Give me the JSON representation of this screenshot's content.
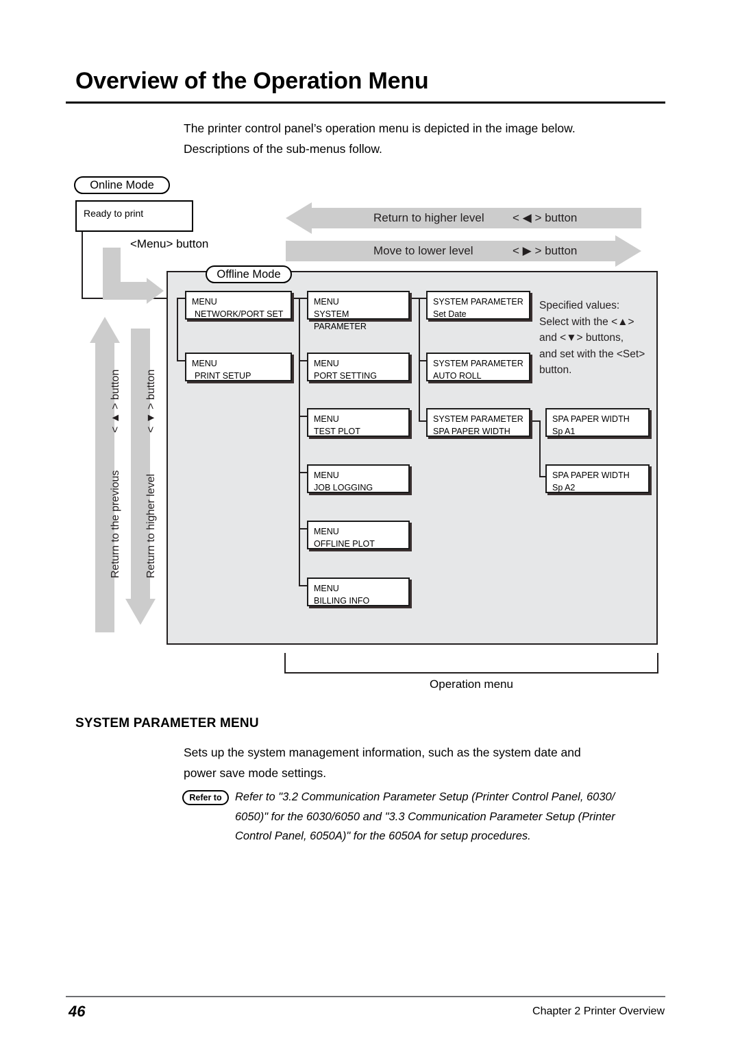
{
  "page": {
    "title": "Overview of the Operation Menu",
    "intro_line1": "The printer control panel’s operation menu is depicted in the image below.",
    "intro_line2": "Descriptions of the sub-menus follow."
  },
  "diagram": {
    "online_mode_pill": "Online Mode",
    "ready_box": "Ready to print",
    "menu_button_label": "<Menu> button",
    "offline_mode_pill": "Offline Mode",
    "operation_menu_caption": "Operation menu",
    "arrows": {
      "top_left_arrow": "Return to higher level",
      "top_left_button": "< ◀ > button",
      "top_right_arrow": "Move to lower level",
      "top_right_button": "< ▶ > button",
      "vert_up_label": "Return to the previous",
      "vert_up_button": "< ▲ > button",
      "vert_down_label": "Return to higher level",
      "vert_down_button": "< ▼ > button"
    },
    "column1": [
      {
        "line1": "MENU",
        "line2": "NETWORK/PORT SET"
      },
      {
        "line1": "MENU",
        "line2": "PRINT SETUP"
      }
    ],
    "column2": [
      {
        "line1": "MENU",
        "line2": "SYSTEM PARAMETER"
      },
      {
        "line1": "MENU",
        "line2": "PORT SETTING"
      },
      {
        "line1": "MENU",
        "line2": "TEST PLOT"
      },
      {
        "line1": "MENU",
        "line2": "JOB LOGGING"
      },
      {
        "line1": "MENU",
        "line2": "OFFLINE PLOT"
      },
      {
        "line1": "MENU",
        "line2": "BILLING INFO"
      }
    ],
    "column3": [
      {
        "line1": "SYSTEM PARAMETER",
        "line2": "Set Date"
      },
      {
        "line1": "SYSTEM PARAMETER",
        "line2": "AUTO ROLL"
      },
      {
        "line1": "SYSTEM PARAMETER",
        "line2": "SPA PAPER WIDTH"
      }
    ],
    "column4": [
      {
        "line1": "SPA PAPER WIDTH",
        "line2": "Sp A1"
      },
      {
        "line1": "SPA PAPER WIDTH",
        "line2": "Sp A2"
      }
    ],
    "specified_values": {
      "l1": "Specified values:",
      "l2": "Select with the <▲>",
      "l3": "and <▼> buttons,",
      "l4": "and set with the <Set>",
      "l5": "button."
    }
  },
  "section": {
    "heading": "SYSTEM PARAMETER MENU",
    "body_line1": "Sets up the system management information, such as the system date and",
    "body_line2": "power save mode settings.",
    "refer_badge": "Refer to",
    "refer_line1": "Refer to \"3.2 Communication Parameter Setup (Printer Control Panel, 6030/",
    "refer_line2": "6050)\" for the 6030/6050 and \"3.3 Communication Parameter Setup (Printer",
    "refer_line3": "Control Panel, 6050A)\" for the 6050A for setup procedures."
  },
  "footer": {
    "page_number": "46",
    "chapter": "Chapter 2  Printer Overview"
  },
  "colors": {
    "arrow_gray": "#cccccc",
    "panel_gray": "#e6e7e8",
    "ink": "#231f20",
    "rule_gray": "#6d6e71"
  }
}
